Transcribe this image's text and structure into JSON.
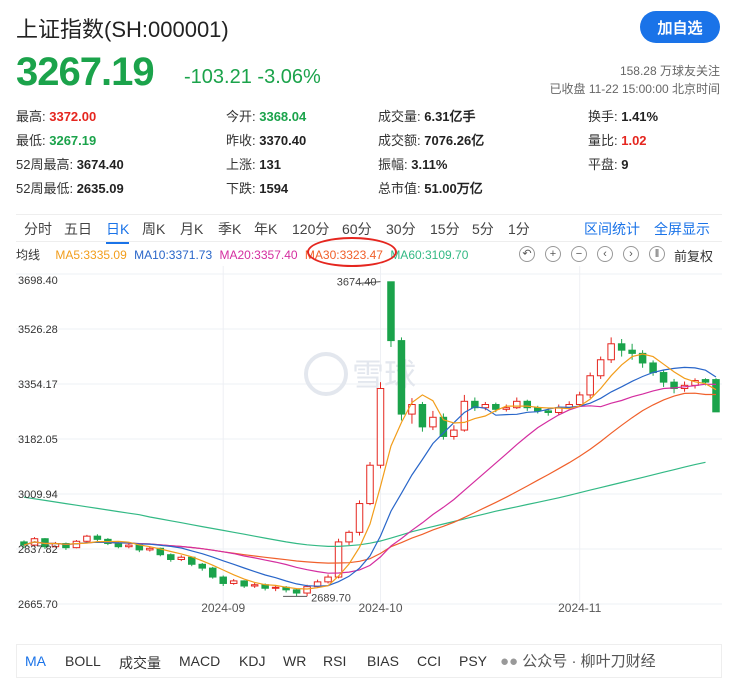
{
  "header": {
    "title": "上证指数(SH:000001)",
    "follow_label": "加自选",
    "price": "3267.19",
    "change": "-103.21",
    "change_pct": "-3.06%",
    "followers": "158.28 万球友关注",
    "status": "已收盘 11-22 15:00:00 北京时间"
  },
  "stats": [
    {
      "label": "最高:",
      "value": "3372.00",
      "color": "red"
    },
    {
      "label": "今开:",
      "value": "3368.04",
      "color": "green"
    },
    {
      "label": "成交量:",
      "value": "6.31亿手",
      "color": ""
    },
    {
      "label": "换手:",
      "value": "1.41%",
      "color": ""
    },
    {
      "label": "最低:",
      "value": "3267.19",
      "color": "green"
    },
    {
      "label": "昨收:",
      "value": "3370.40",
      "color": ""
    },
    {
      "label": "成交额:",
      "value": "7076.26亿",
      "color": ""
    },
    {
      "label": "量比:",
      "value": "1.02",
      "color": "red"
    },
    {
      "label": "52周最高:",
      "value": "3674.40",
      "color": ""
    },
    {
      "label": "上涨:",
      "value": "131",
      "color": ""
    },
    {
      "label": "振幅:",
      "value": "3.11%",
      "color": ""
    },
    {
      "label": "平盘:",
      "value": "9",
      "color": ""
    },
    {
      "label": "52周最低:",
      "value": "2635.09",
      "color": ""
    },
    {
      "label": "下跌:",
      "value": "1594",
      "color": ""
    },
    {
      "label": "总市值:",
      "value": "51.00万亿",
      "color": ""
    }
  ],
  "periods": [
    "分时",
    "五日",
    "日K",
    "周K",
    "月K",
    "季K",
    "年K",
    "120分",
    "60分",
    "30分",
    "15分",
    "5分",
    "1分"
  ],
  "active_period": "日K",
  "period_links": [
    "区间统计",
    "全屏显示"
  ],
  "ma_legend": {
    "avg": "均线",
    "ma5": "MA5:3335.09",
    "ma10": "MA10:3371.73",
    "ma20": "MA20:3357.40",
    "ma30": "MA30:3323.47",
    "ma60": "MA60:3109.70"
  },
  "tool_icons": [
    "left-arrow-icon",
    "zoom-in-icon",
    "zoom-out-icon",
    "prev-icon",
    "next-icon",
    "pause-icon"
  ],
  "adjust_label": "前复权",
  "watermark_logo": "雪球",
  "indicators": [
    "MA",
    "BOLL",
    "成交量",
    "MACD",
    "KDJ",
    "WR",
    "RSI",
    "BIAS",
    "CCI",
    "PSY"
  ],
  "active_indicator": "MA",
  "footer_watermark": "公众号 · 柳叶刀财经",
  "colors": {
    "up": "#e5261f",
    "down": "#1ba34b",
    "ma5": "#f29d1b",
    "ma10": "#2966c9",
    "ma20": "#d42ea0",
    "ma30": "#f0602b",
    "ma60": "#33b985",
    "accent": "#1a73e8"
  },
  "chart_data": {
    "type": "candlestick",
    "y_ticks": [
      "3698.40",
      "3526.28",
      "3354.17",
      "3182.05",
      "3009.94",
      "2837.82",
      "2665.70"
    ],
    "y_tick_values": [
      3698.4,
      3526.28,
      3354.17,
      3182.05,
      3009.94,
      2837.82,
      2665.7
    ],
    "ylim": [
      2665.7,
      3698.4
    ],
    "x_ticks": [
      "2024-09",
      "2024-10",
      "2024-11"
    ],
    "x_tick_index": [
      19,
      34,
      53
    ],
    "annotations": [
      {
        "text": "3674.40",
        "index": 34,
        "value": 3674.4
      },
      {
        "text": "2689.70",
        "index": 27,
        "value": 2689.7
      }
    ],
    "candles": [
      {
        "o": 2860,
        "c": 2850,
        "h": 2865,
        "l": 2840
      },
      {
        "o": 2850,
        "c": 2870,
        "h": 2875,
        "l": 2845
      },
      {
        "o": 2870,
        "c": 2845,
        "h": 2872,
        "l": 2838
      },
      {
        "o": 2845,
        "c": 2855,
        "h": 2860,
        "l": 2842
      },
      {
        "o": 2855,
        "c": 2842,
        "h": 2858,
        "l": 2835
      },
      {
        "o": 2842,
        "c": 2862,
        "h": 2866,
        "l": 2840
      },
      {
        "o": 2862,
        "c": 2878,
        "h": 2882,
        "l": 2858
      },
      {
        "o": 2878,
        "c": 2868,
        "h": 2884,
        "l": 2862
      },
      {
        "o": 2868,
        "c": 2855,
        "h": 2872,
        "l": 2850
      },
      {
        "o": 2855,
        "c": 2845,
        "h": 2860,
        "l": 2840
      },
      {
        "o": 2845,
        "c": 2850,
        "h": 2856,
        "l": 2840
      },
      {
        "o": 2850,
        "c": 2835,
        "h": 2852,
        "l": 2828
      },
      {
        "o": 2835,
        "c": 2840,
        "h": 2846,
        "l": 2830
      },
      {
        "o": 2840,
        "c": 2820,
        "h": 2842,
        "l": 2815
      },
      {
        "o": 2820,
        "c": 2805,
        "h": 2824,
        "l": 2798
      },
      {
        "o": 2805,
        "c": 2812,
        "h": 2818,
        "l": 2800
      },
      {
        "o": 2812,
        "c": 2790,
        "h": 2814,
        "l": 2784
      },
      {
        "o": 2790,
        "c": 2778,
        "h": 2794,
        "l": 2770
      },
      {
        "o": 2778,
        "c": 2750,
        "h": 2782,
        "l": 2745
      },
      {
        "o": 2750,
        "c": 2730,
        "h": 2755,
        "l": 2722
      },
      {
        "o": 2730,
        "c": 2738,
        "h": 2744,
        "l": 2726
      },
      {
        "o": 2738,
        "c": 2722,
        "h": 2740,
        "l": 2716
      },
      {
        "o": 2722,
        "c": 2726,
        "h": 2732,
        "l": 2716
      },
      {
        "o": 2726,
        "c": 2715,
        "h": 2730,
        "l": 2708
      },
      {
        "o": 2715,
        "c": 2718,
        "h": 2724,
        "l": 2706
      },
      {
        "o": 2718,
        "c": 2710,
        "h": 2722,
        "l": 2702
      },
      {
        "o": 2710,
        "c": 2700,
        "h": 2714,
        "l": 2690
      },
      {
        "o": 2700,
        "c": 2720,
        "h": 2726,
        "l": 2690
      },
      {
        "o": 2720,
        "c": 2735,
        "h": 2742,
        "l": 2716
      },
      {
        "o": 2735,
        "c": 2750,
        "h": 2758,
        "l": 2730
      },
      {
        "o": 2750,
        "c": 2860,
        "h": 2870,
        "l": 2746
      },
      {
        "o": 2860,
        "c": 2890,
        "h": 2896,
        "l": 2850
      },
      {
        "o": 2890,
        "c": 2980,
        "h": 2990,
        "l": 2880
      },
      {
        "o": 2980,
        "c": 3100,
        "h": 3110,
        "l": 2975
      },
      {
        "o": 3100,
        "c": 3340,
        "h": 3360,
        "l": 3090
      },
      {
        "o": 3674,
        "c": 3490,
        "h": 3674,
        "l": 3470
      },
      {
        "o": 3490,
        "c": 3260,
        "h": 3500,
        "l": 3240
      },
      {
        "o": 3260,
        "c": 3290,
        "h": 3310,
        "l": 3230
      },
      {
        "o": 3290,
        "c": 3220,
        "h": 3298,
        "l": 3205
      },
      {
        "o": 3220,
        "c": 3250,
        "h": 3270,
        "l": 3210
      },
      {
        "o": 3250,
        "c": 3190,
        "h": 3262,
        "l": 3180
      },
      {
        "o": 3190,
        "c": 3210,
        "h": 3225,
        "l": 3180
      },
      {
        "o": 3210,
        "c": 3300,
        "h": 3320,
        "l": 3205
      },
      {
        "o": 3300,
        "c": 3280,
        "h": 3312,
        "l": 3270
      },
      {
        "o": 3280,
        "c": 3290,
        "h": 3298,
        "l": 3272
      },
      {
        "o": 3290,
        "c": 3275,
        "h": 3296,
        "l": 3266
      },
      {
        "o": 3275,
        "c": 3280,
        "h": 3290,
        "l": 3268
      },
      {
        "o": 3280,
        "c": 3300,
        "h": 3312,
        "l": 3276
      },
      {
        "o": 3300,
        "c": 3280,
        "h": 3305,
        "l": 3270
      },
      {
        "o": 3280,
        "c": 3270,
        "h": 3286,
        "l": 3262
      },
      {
        "o": 3270,
        "c": 3265,
        "h": 3278,
        "l": 3255
      },
      {
        "o": 3265,
        "c": 3280,
        "h": 3290,
        "l": 3258
      },
      {
        "o": 3280,
        "c": 3290,
        "h": 3300,
        "l": 3275
      },
      {
        "o": 3290,
        "c": 3320,
        "h": 3330,
        "l": 3285
      },
      {
        "o": 3320,
        "c": 3380,
        "h": 3390,
        "l": 3310
      },
      {
        "o": 3380,
        "c": 3430,
        "h": 3440,
        "l": 3370
      },
      {
        "o": 3430,
        "c": 3480,
        "h": 3500,
        "l": 3420
      },
      {
        "o": 3480,
        "c": 3460,
        "h": 3495,
        "l": 3440
      },
      {
        "o": 3460,
        "c": 3450,
        "h": 3480,
        "l": 3430
      },
      {
        "o": 3450,
        "c": 3420,
        "h": 3460,
        "l": 3405
      },
      {
        "o": 3420,
        "c": 3390,
        "h": 3428,
        "l": 3380
      },
      {
        "o": 3390,
        "c": 3360,
        "h": 3398,
        "l": 3345
      },
      {
        "o": 3360,
        "c": 3340,
        "h": 3370,
        "l": 3325
      },
      {
        "o": 3340,
        "c": 3350,
        "h": 3362,
        "l": 3330
      },
      {
        "o": 3350,
        "c": 3365,
        "h": 3372,
        "l": 3340
      },
      {
        "o": 3368,
        "c": 3360,
        "h": 3372,
        "l": 3350
      },
      {
        "o": 3368,
        "c": 3267,
        "h": 3372,
        "l": 3267
      }
    ],
    "ma60": [
      3000,
      2995,
      2990,
      2985,
      2980,
      2975,
      2970,
      2965,
      2960,
      2955,
      2950,
      2945,
      2938,
      2932,
      2926,
      2920,
      2914,
      2908,
      2902,
      2896,
      2890,
      2884,
      2878,
      2872,
      2866,
      2860,
      2855,
      2851,
      2848,
      2846,
      2846,
      2848,
      2851,
      2856,
      2863,
      2872,
      2882,
      2892,
      2900,
      2908,
      2916,
      2924,
      2932,
      2940,
      2948,
      2956,
      2963,
      2970,
      2977,
      2984,
      2991,
      2998,
      3006,
      3014,
      3022,
      3030,
      3038,
      3046,
      3054,
      3062,
      3070,
      3078,
      3086,
      3094,
      3102,
      3109
    ]
  }
}
